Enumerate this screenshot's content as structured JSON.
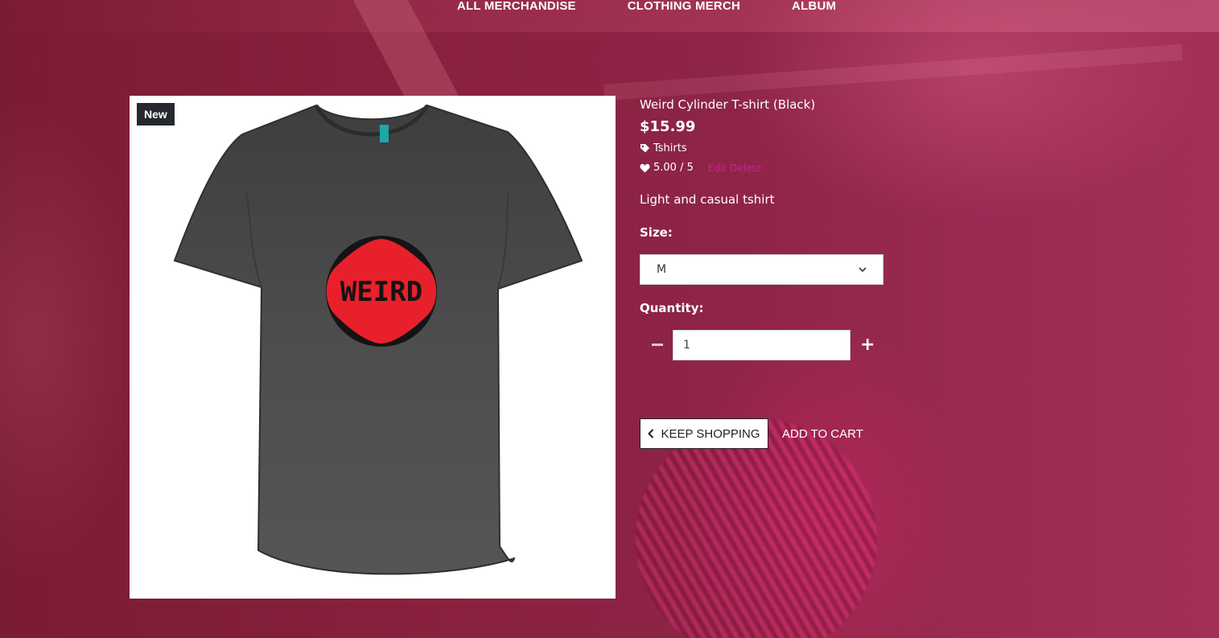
{
  "nav": {
    "items": [
      "ALL MERCHANDISE",
      "CLOTHING MERCH",
      "ALBUM"
    ]
  },
  "product": {
    "badge": "New",
    "graphic_text": "WEIRD",
    "title": "Weird Cylinder T-shirt (Black)",
    "price": "$15.99",
    "category": "Tshirts",
    "rating": "5.00 / 5",
    "rating_value": 5.0,
    "admin_edit": "Edit",
    "admin_delete": "Delete",
    "description": "Light and casual tshirt",
    "size_label": "Size:",
    "size_selected": "M",
    "quantity_label": "Quantity:",
    "quantity_value": "1",
    "keep_shopping": "KEEP SHOPPING",
    "add_to_cart": "ADD TO CART"
  },
  "icons": {
    "category": "tag-icon",
    "rating": "heart-icon",
    "keep_shopping": "chevron-left-icon",
    "select": "chevron-down-icon",
    "qty_minus": "minus-icon",
    "qty_plus": "plus-icon"
  },
  "colors": {
    "background": "#8a2140",
    "badge": "#25282c",
    "admin_links": "#c2278c",
    "shirt": "#4a4a4a",
    "graphic_red": "#e8202b"
  }
}
